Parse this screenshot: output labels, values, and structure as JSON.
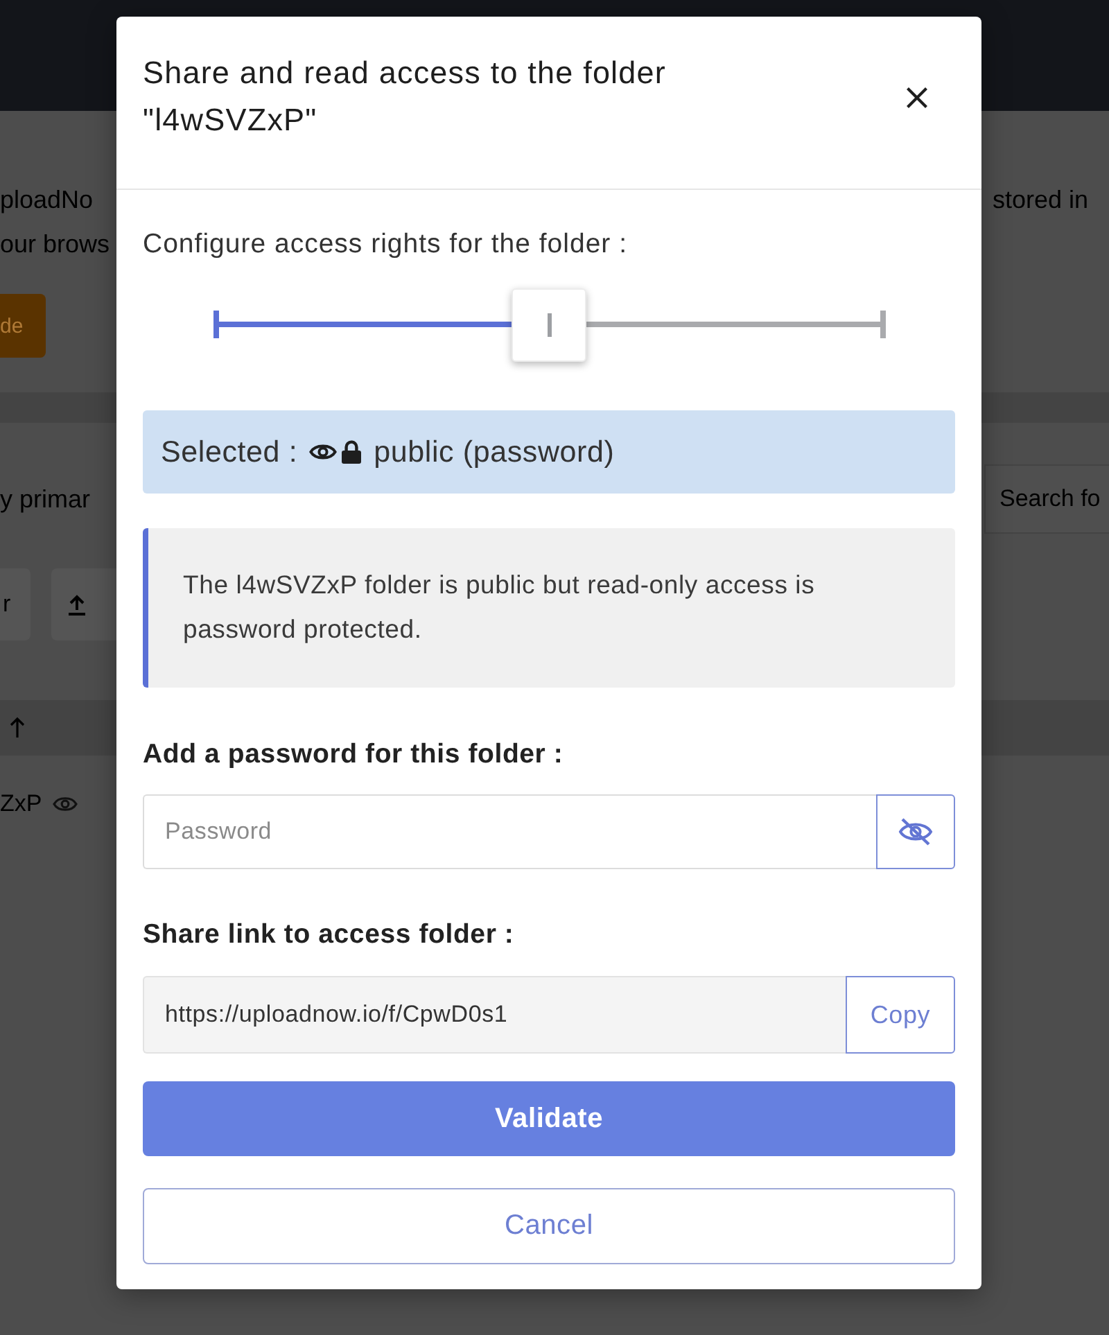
{
  "background": {
    "intro_lines": [
      "ploadNo",
      "our brows"
    ],
    "intro_aside": "stored in",
    "action_button": "de",
    "section_title": "y primar",
    "search": {
      "placeholder": "Search fo"
    },
    "toolbar_buttons": [
      {
        "kind": "text",
        "label": "r"
      },
      {
        "kind": "upload"
      }
    ],
    "table": {
      "rows": [
        {
          "name": "ZxP"
        }
      ]
    }
  },
  "dialog": {
    "title": "Share and read access to the folder \"l4wSVZxP\"",
    "access_label": "Configure access rights for the folder :",
    "access_slider": {
      "level": 0.5
    },
    "selection": {
      "label": "Selected :",
      "value": "public (password)"
    },
    "notice": "The l4wSVZxP folder is public but read-only access is password protected.",
    "password": {
      "label": "Add a password for this folder :",
      "placeholder": "Password",
      "revealed": false
    },
    "share_link": {
      "label": "Share link to access folder :",
      "value": "https://uploadnow.io/f/CpwD0s1",
      "copy_button": "Copy"
    },
    "buttons": [
      {
        "label": "Validate",
        "kind": "primary"
      },
      {
        "label": "Cancel",
        "kind": "secondary"
      }
    ]
  }
}
